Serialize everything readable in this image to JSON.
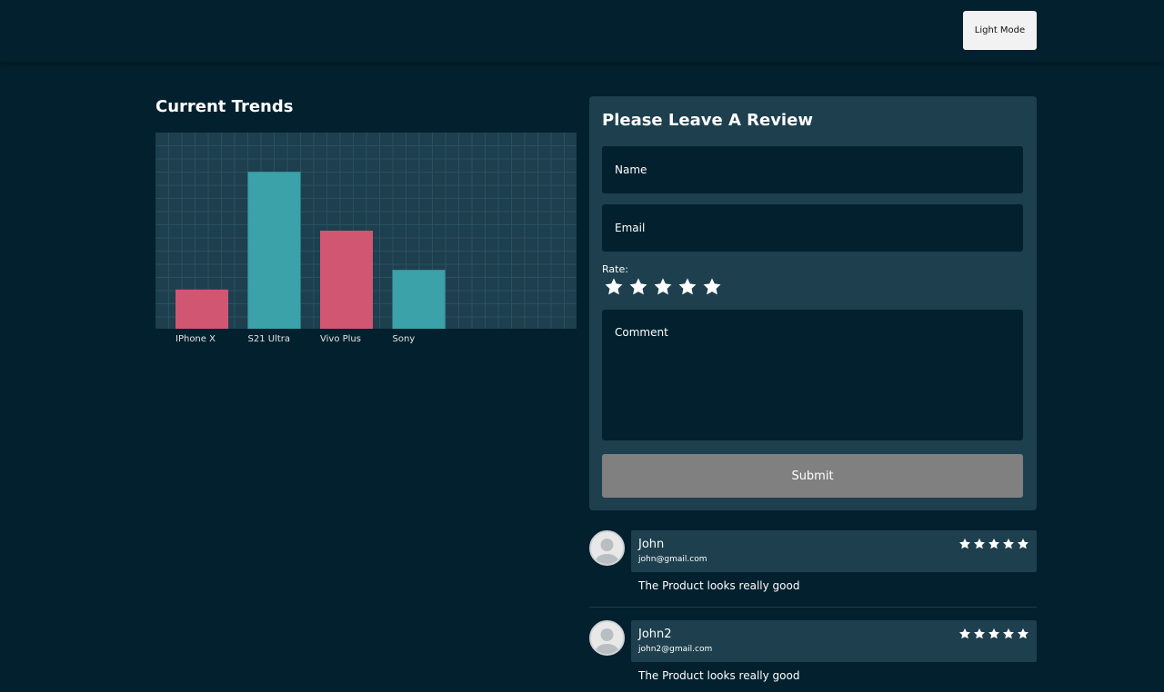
{
  "header": {
    "mode_button": "Light Mode"
  },
  "trends": {
    "title": "Current Trends"
  },
  "chart_data": {
    "type": "bar",
    "title": "Current Trends",
    "categories": [
      "IPhone X",
      "S21 Ultra",
      "Vivo Plus",
      "Sony"
    ],
    "values": [
      20,
      80,
      50,
      30
    ],
    "ylim": [
      0,
      100
    ],
    "bar_colors": [
      "#d15672",
      "#3aa2a8",
      "#d15672",
      "#3aa2a8"
    ],
    "grid": true,
    "background": "#1d3f4e",
    "grid_color": "#2a5060"
  },
  "review_form": {
    "title": "Please Leave A Review",
    "name_placeholder": "Name",
    "email_placeholder": "Email",
    "rate_label": "Rate:",
    "rating_max": 5,
    "comment_placeholder": "Comment",
    "submit_label": "Submit"
  },
  "reviews": [
    {
      "name": "John",
      "email": "john@gmail.com",
      "rating": 5,
      "text": "The Product looks really good"
    },
    {
      "name": "John2",
      "email": "john2@gmail.com",
      "rating": 5,
      "text": "The Product looks really good"
    }
  ],
  "colors": {
    "background": "#03202e",
    "panel": "#1d3f4e",
    "accent_pink": "#d15672",
    "accent_teal": "#3aa2a8",
    "submit_gray": "#808080"
  }
}
